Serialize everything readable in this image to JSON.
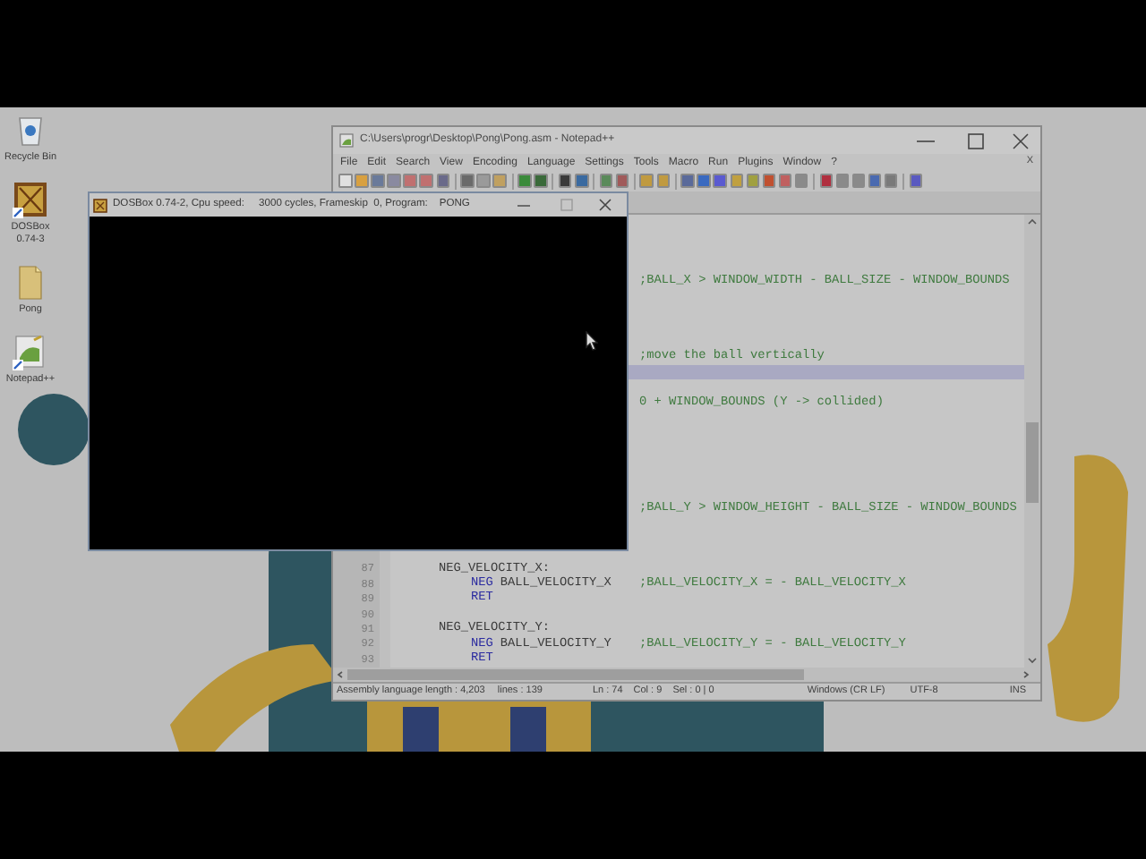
{
  "desktop_icons": [
    {
      "label": "Recycle Bin",
      "kind": "recycle-bin"
    },
    {
      "label": "DOSBox 0.74-3",
      "kind": "dosbox"
    },
    {
      "label": "Pong",
      "kind": "folder"
    },
    {
      "label": "Notepad++",
      "kind": "notepad"
    }
  ],
  "notepad": {
    "title": "C:\\Users\\progr\\Desktop\\Pong\\Pong.asm - Notepad++",
    "menu": [
      "File",
      "Edit",
      "Search",
      "View",
      "Encoding",
      "Language",
      "Settings",
      "Tools",
      "Macro",
      "Run",
      "Plugins",
      "Window",
      "?"
    ],
    "close_document": "X",
    "editor_rows": [
      {
        "kind": "blank",
        "current": false
      },
      {
        "kind": "blank",
        "current": false
      },
      {
        "kind": "blank",
        "current": false
      },
      {
        "kind": "blank",
        "current": false
      },
      {
        "kind": "fragment",
        "comment": ";BALL_X > WINDOW_WIDTH - BALL_SIZE  - WINDOW_BOUNDS",
        "current": false
      },
      {
        "kind": "blank",
        "current": false
      },
      {
        "kind": "blank",
        "current": false
      },
      {
        "kind": "blank",
        "current": false
      },
      {
        "kind": "blank",
        "current": false
      },
      {
        "kind": "fragment",
        "comment": ";move the ball vertically",
        "current": false
      },
      {
        "kind": "blank",
        "current": true
      },
      {
        "kind": "blank",
        "current": false
      },
      {
        "kind": "fragment",
        "comment": "0 + WINDOW_BOUNDS (Y -> collided)",
        "current": false
      },
      {
        "kind": "blank",
        "current": false
      },
      {
        "kind": "blank",
        "current": false
      },
      {
        "kind": "blank",
        "current": false
      },
      {
        "kind": "blank",
        "current": false
      },
      {
        "kind": "blank",
        "current": false
      },
      {
        "kind": "blank",
        "current": false
      },
      {
        "kind": "fragment",
        "comment": ";BALL_Y > WINDOW_HEIGHT - BALL_SIZE - WINDOW_BOUNDS",
        "current": false
      },
      {
        "kind": "blank",
        "current": false
      },
      {
        "kind": "blank",
        "current": false
      },
      {
        "kind": "blank",
        "current": false
      },
      {
        "kind": "label",
        "number": "87",
        "text": "NEG_VELOCITY_X:",
        "current": false
      },
      {
        "kind": "instruction",
        "number": "88",
        "mnemonic": "NEG",
        "operand": "BALL_VELOCITY_X",
        "comment": ";BALL_VELOCITY_X = - BALL_VELOCITY_X",
        "current": false
      },
      {
        "kind": "instruction",
        "number": "89",
        "mnemonic": "RET",
        "current": false
      },
      {
        "kind": "blank",
        "number": "90",
        "current": false
      },
      {
        "kind": "label",
        "number": "91",
        "text": "NEG_VELOCITY_Y:",
        "current": false
      },
      {
        "kind": "instruction",
        "number": "92",
        "mnemonic": "NEG",
        "operand": "BALL_VELOCITY_Y",
        "comment": ";BALL_VELOCITY_Y = - BALL_VELOCITY_Y",
        "current": false
      },
      {
        "kind": "instruction",
        "number": "93",
        "mnemonic": "RET",
        "current": false
      }
    ],
    "status_bar": [
      "Assembly language length : 4,203",
      "lines : 139",
      "Ln : 74",
      "Col : 9",
      "Sel : 0 | 0",
      "Windows (CR LF)",
      "UTF-8",
      "INS"
    ]
  },
  "dosbox": {
    "title": "DOSBox 0.74-2, Cpu speed:     3000 cycles, Frameskip  0, Program:    PONG"
  }
}
